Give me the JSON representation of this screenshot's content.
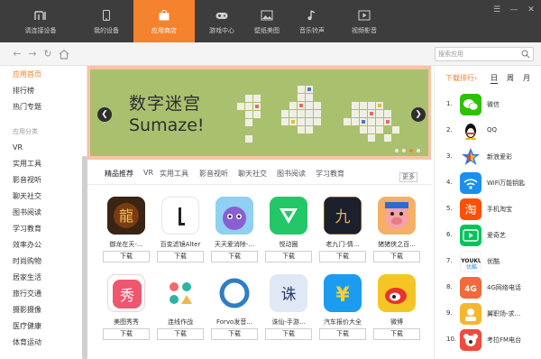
{
  "nav": {
    "tabs": [
      {
        "label": "请连接设备",
        "icon": "mi-logo-icon"
      },
      {
        "label": "我的设备",
        "icon": "phone-icon"
      },
      {
        "label": "应用商店",
        "icon": "shopping-bag-icon"
      },
      {
        "label": "游戏中心",
        "icon": "gamepad-icon"
      },
      {
        "label": "壁纸美图",
        "icon": "picture-icon"
      },
      {
        "label": "音乐铃声",
        "icon": "music-note-icon"
      },
      {
        "label": "视频影音",
        "icon": "play-icon"
      }
    ],
    "active_tab": "应用商店",
    "accent_color": "#f5822c",
    "window_controls": [
      "menu-icon",
      "minimize-icon",
      "close-icon"
    ]
  },
  "toolbar": {
    "search_placeholder": "搜索应用",
    "buttons": [
      "back-icon",
      "forward-icon",
      "refresh-icon",
      "home-icon"
    ]
  },
  "sidebar": {
    "top_items": [
      "应用首页",
      "排行榜",
      "热门专题"
    ],
    "section_label": "应用分类",
    "category_items": [
      "VR",
      "实用工具",
      "影音视听",
      "聊天社交",
      "图书阅读",
      "学习教育",
      "效率办公",
      "时尚购物",
      "居家生活",
      "旅行交通",
      "摄影摄像",
      "医疗健康",
      "体育运动"
    ]
  },
  "banner": {
    "title": "数字迷宫",
    "subtitle": "Sumaze!",
    "background_color": "#a9c16f"
  },
  "categories": {
    "tabs": [
      "精品推荐",
      "VR",
      "实用工具",
      "影音视听",
      "聊天社交",
      "图书阅读",
      "学习教育"
    ],
    "more_label": "更多"
  },
  "apps": [
    {
      "name": "御龙在天-...",
      "download": "下载"
    },
    {
      "name": "百变滤镜Alter",
      "download": "下载"
    },
    {
      "name": "天天爱消除-...",
      "download": "下载"
    },
    {
      "name": "悦动圈",
      "download": "下载"
    },
    {
      "name": "老九门-情...",
      "download": "下载"
    },
    {
      "name": "猪猪侠之百...",
      "download": "下载"
    },
    {
      "name": "美图秀秀",
      "download": "下载"
    },
    {
      "name": "连线作战",
      "download": "下载"
    },
    {
      "name": "Forvo发音...",
      "download": "下载"
    },
    {
      "name": "诛仙-手游...",
      "download": "下载"
    },
    {
      "name": "汽车报价大全",
      "download": "下载"
    },
    {
      "name": "微博",
      "download": "下载"
    }
  ],
  "rank": {
    "title": "下载排行",
    "tabs": [
      "日",
      "周",
      "月"
    ],
    "items": [
      {
        "num": "1.",
        "name": "微信"
      },
      {
        "num": "2.",
        "name": "QQ"
      },
      {
        "num": "3.",
        "name": "新浪爱彩"
      },
      {
        "num": "4.",
        "name": "WiFi万能钥匙"
      },
      {
        "num": "5.",
        "name": "手机淘宝"
      },
      {
        "num": "6.",
        "name": "爱奇艺"
      },
      {
        "num": "7.",
        "name": "优酷"
      },
      {
        "num": "8.",
        "name": "4G网络电话"
      },
      {
        "num": "9.",
        "name": "翼职场-求..."
      },
      {
        "num": "10.",
        "name": "考拉FM电台"
      }
    ]
  }
}
